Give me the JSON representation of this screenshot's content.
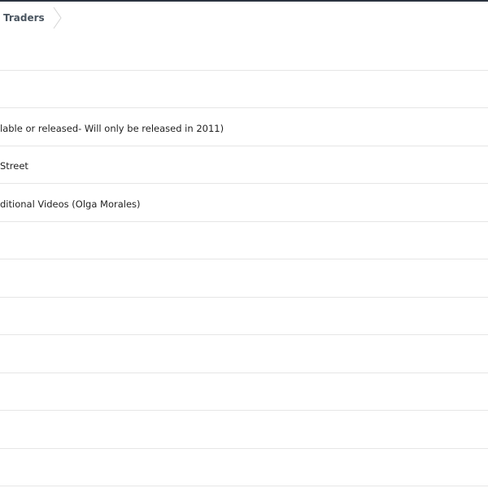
{
  "breadcrumb": {
    "current": "Traders"
  },
  "rows": [
    {
      "text": ""
    },
    {
      "text": ""
    },
    {
      "text": "lable or released- Will only be released in 2011)"
    },
    {
      "text": "Street"
    },
    {
      "text": "ditional Videos (Olga Morales)"
    },
    {
      "text": ""
    },
    {
      "text": ""
    },
    {
      "text": ""
    },
    {
      "text": ""
    },
    {
      "text": ""
    },
    {
      "text": ""
    },
    {
      "text": ""
    }
  ]
}
